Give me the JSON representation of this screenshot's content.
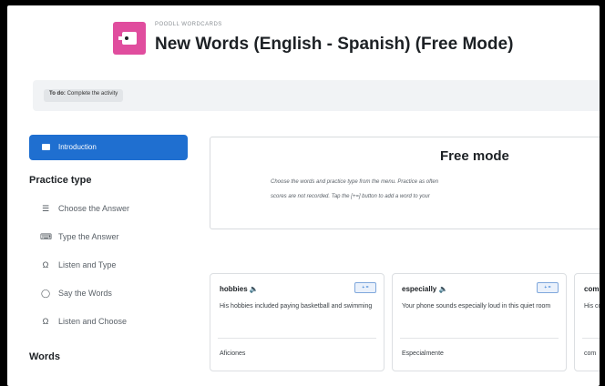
{
  "header": {
    "module_label": "POODLL WORDCARDS",
    "title": "New Words (English - Spanish) (Free Mode)"
  },
  "todo": {
    "label": "To do:",
    "text": "Complete the activity"
  },
  "sidebar": {
    "intro_label": "Introduction",
    "practice_heading": "Practice type",
    "practice_items": [
      {
        "label": "Choose the Answer",
        "icon": "list-icon"
      },
      {
        "label": "Type the Answer",
        "icon": "keyboard-icon"
      },
      {
        "label": "Listen and Type",
        "icon": "headphones-icon"
      },
      {
        "label": "Say the Words",
        "icon": "speech-bubble-icon"
      },
      {
        "label": "Listen and Choose",
        "icon": "headphones-icon"
      }
    ],
    "words_heading": "Words"
  },
  "freemode": {
    "title": "Free mode",
    "desc_line1": "Choose the words and practice type from the menu.  Practice as often",
    "desc_line2": "scores  are not recorded.  Tap the [+=] button to add a word to your"
  },
  "cards": [
    {
      "word": "hobbies",
      "sentence": "His hobbies included paying basketball and swimming",
      "translation": "Aficiones",
      "badge": "+ ="
    },
    {
      "word": "especially",
      "sentence": "Your phone sounds especially loud in this quiet room",
      "translation": "Especialmente",
      "badge": "+ ="
    },
    {
      "word": "com",
      "sentence": "His com",
      "translation": "com",
      "badge": "+ ="
    }
  ],
  "colors": {
    "accent_blue": "#1f6fd0",
    "brand_pink": "#e04d9e"
  }
}
